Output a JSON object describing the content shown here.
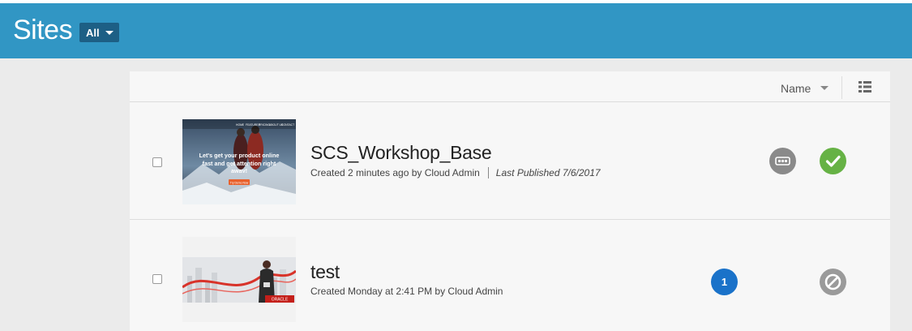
{
  "header": {
    "title": "Sites",
    "filter": {
      "selected": "All"
    }
  },
  "toolbar": {
    "sort_label": "Name",
    "icons": {
      "sort": "chevron-down-icon",
      "view": "list-view-icon"
    }
  },
  "sites": [
    {
      "name": "SCS_Workshop_Base",
      "created": "Created 2 minutes ago by Cloud Admin",
      "published": "Last Published 7/6/2017",
      "thumbnail": {
        "headline": "Let's get your product online fast and get attention right away!",
        "nav": [
          "HOME",
          "FEATURES",
          "PRICING",
          "ABOUT US",
          "CONTACT"
        ],
        "cta": "Try Demo Now"
      },
      "status": "published",
      "colors": {
        "status": "#66b245",
        "more": "#8a8a8a"
      }
    },
    {
      "name": "test",
      "created": "Created Monday at 2:41 PM by Cloud Admin",
      "badge_count": "1",
      "thumbnail": {
        "logo": "ORACLE"
      },
      "status": "unpublished",
      "colors": {
        "badge": "#1a72c9",
        "status": "#9a9a9a"
      }
    }
  ],
  "colors": {
    "header": "#3196c4",
    "filter": "#1d5f85",
    "page": "#ebebeb",
    "panel": "#f7f7f7"
  }
}
